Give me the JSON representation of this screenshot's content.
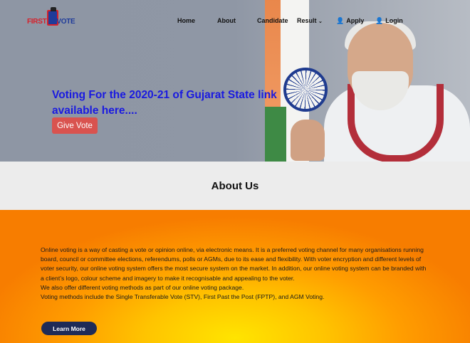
{
  "brand": {
    "first": "FIRST",
    "vote": "VOTE"
  },
  "nav": {
    "home": "Home",
    "about": "About",
    "candidate": "Candidate",
    "result": "Result",
    "apply": "Apply",
    "login": "Login"
  },
  "hero": {
    "headline": "Voting For the 2020-21 of Gujarat State link available here....",
    "button": "Give Vote"
  },
  "about": {
    "title": "About Us",
    "paragraph1": "Online voting is a way of casting a vote or opinion online, via electronic means. It is a preferred voting channel for many organisations running board, council or committee elections, referendums, polls or AGMs, due to its ease and flexibility. With voter encryption and different levels of voter security, our online voting system offers the most secure system on the market. In addition, our online voting system can be branded with a client’s logo, colour scheme and imagery to make it recognisable and appealing to the voter.",
    "paragraph2": "We also offer different voting methods as part of our online voting package.",
    "paragraph3": "Voting methods include the Single Transferable Vote (STV), First Past the Post (FPTP), and AGM Voting.",
    "button": "Learn More"
  },
  "colors": {
    "headline": "#1a1ae0",
    "give_button": "#d9534f",
    "learn_button": "#1f2b57"
  }
}
